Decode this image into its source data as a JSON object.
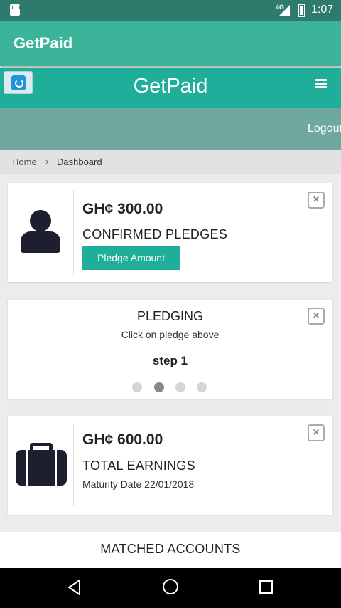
{
  "status_bar": {
    "network": "4G",
    "time": "1:07"
  },
  "app_bar": {
    "title": "GetPaid"
  },
  "web_header": {
    "brand": "GetPaid",
    "refresh_icon": "refresh-icon",
    "menu_icon": "hamburger-icon"
  },
  "logout_bar": {
    "logout_label": "Logout"
  },
  "breadcrumb": {
    "home": "Home",
    "separator": "›",
    "current": "Dashboard"
  },
  "pledges_card": {
    "amount": "GH¢ 300.00",
    "label": "CONFIRMED PLEDGES",
    "button_label": "Pledge Amount",
    "icon": "user-icon",
    "close": "×"
  },
  "pledging_card": {
    "title": "PLEDGING",
    "subtitle": "Click on pledge above",
    "step": "step 1",
    "total_steps": 4,
    "active_step_index": 1,
    "close": "×"
  },
  "earnings_card": {
    "amount": "GH¢ 600.00",
    "label": "TOTAL EARNINGS",
    "maturity": "Maturity Date 22/01/2018",
    "icon": "briefcase-icon",
    "close": "×"
  },
  "matched_accounts": {
    "title": "MATCHED ACCOUNTS"
  },
  "colors": {
    "status_bar": "#2e7a6c",
    "app_bar": "#3cb49a",
    "accent": "#1fae99",
    "logout_bar": "#6ea8a0"
  }
}
